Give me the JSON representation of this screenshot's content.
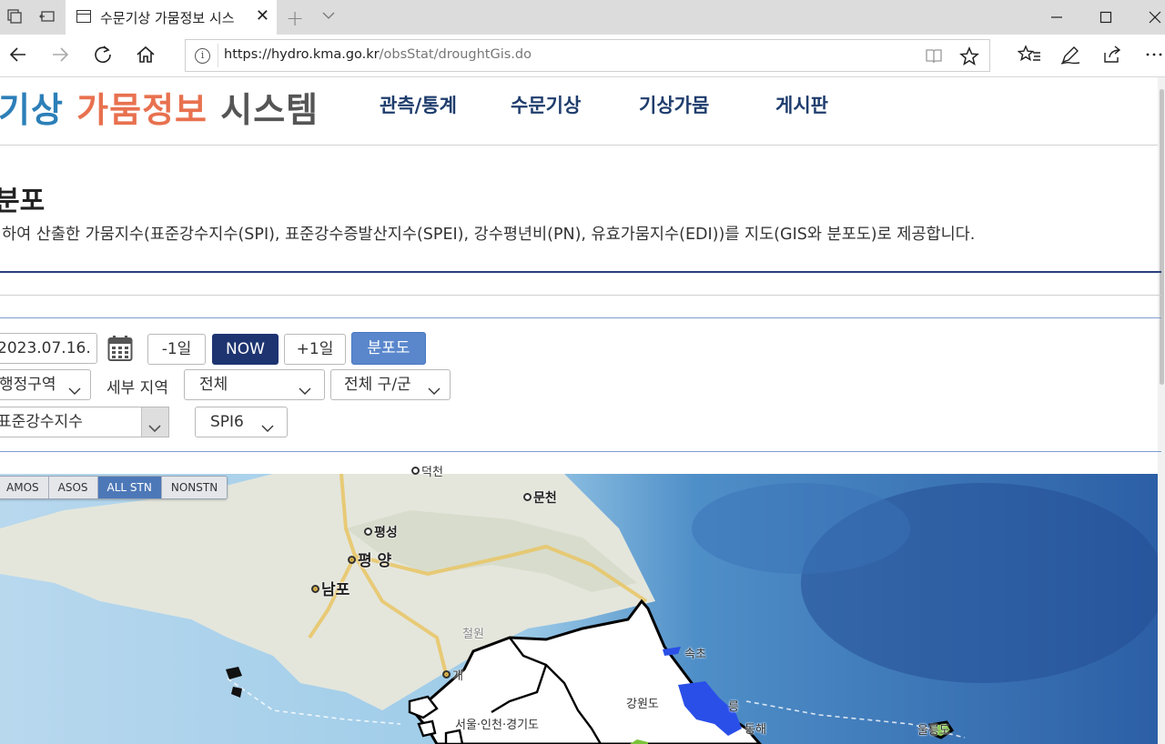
{
  "browser": {
    "tab_title": "수문기상 가뭄정보 시스",
    "url_host": "https://hydro.kma.go.kr",
    "url_path": "/obsStat/droughtGis.do"
  },
  "site": {
    "logo": {
      "part1": "기상",
      "part2": "가뭄정보",
      "part3": "시스템"
    },
    "nav": [
      "관측/통계",
      "수문기상",
      "기상가뭄",
      "게시판"
    ]
  },
  "page": {
    "title": "분포",
    "description": "하여 산출한 가뭄지수(표준강수지수(SPI), 표준강수증발산지수(SPEI), 강수평년비(PN), 유효가뭄지수(EDI))를 지도(GIS와 분포도)로 제공합니다."
  },
  "controls": {
    "date": "2023.07.16.",
    "prev_day": "-1일",
    "now": "NOW",
    "next_day": "+1일",
    "distribution": "분포도",
    "region_type": "행정구역",
    "detail_region_label": "세부 지역",
    "detail_region": "전체",
    "district": "전체 구/군",
    "index_type": "표준강수지수",
    "index_period": "SPI6"
  },
  "station_tabs": [
    {
      "label": "AMOS",
      "active": false
    },
    {
      "label": "ASOS",
      "active": false
    },
    {
      "label": "ALL STN",
      "active": true
    },
    {
      "label": "NONSTN",
      "active": false
    }
  ],
  "map": {
    "labels": {
      "top_cut": "덕천",
      "munchon": "문천",
      "pyongsong": "평성",
      "pyongyang": "평 양",
      "nampo": "남포",
      "cheorwon": "철원",
      "kaesong": "개",
      "sokcho": "속초",
      "gangneung_cut": "릉",
      "donghae": "동해",
      "gangwon": "강원도",
      "seoul_region": "서울·인천·경기도",
      "ulleung": "울릉도"
    },
    "colors": {
      "sea": "#4a85c0",
      "land_north": "#e6e9e0",
      "south_korea": "#ffffff",
      "drought_blue": "#2a4fe8",
      "green_patch": "#79c23a"
    }
  }
}
